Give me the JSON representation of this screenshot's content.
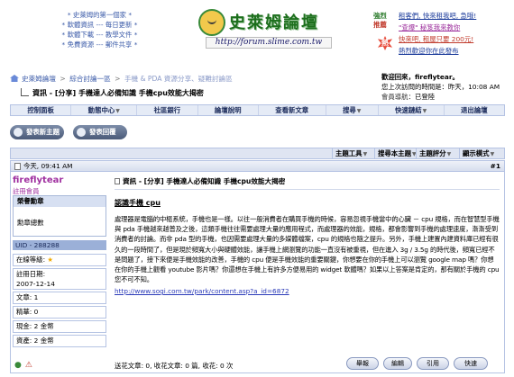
{
  "banner": {
    "promo_left": [
      "* 史萊姆的第一個家 *",
      "* 軟體資訊 --- 每日更新 *",
      "* 軟體下載 --- 教學文件 *",
      "* 免費資源 --- 郵件共享 *"
    ],
    "logo_title": "史萊姆論壇",
    "logo_url": "http://forum.slime.com.tw",
    "promo_right": {
      "tag_a": "強烈",
      "tag_b": "推薦",
      "badge": "熱",
      "lines": [
        "租客們, 快來租我吧, 急哦!",
        "\"查爆\" 秘笈我來教你",
        "快來吧, 租屋只要 200元!",
        "熱烈歡迎你在此發布"
      ]
    }
  },
  "breadcrumb": {
    "items": [
      "史萊姆論壇",
      "綜合討論一區",
      "手機 & PDA 資源分享、疑難討論區"
    ],
    "separator": ">"
  },
  "thread_title": "資訊 - [分享] 手機達人必備知識  手機cpu效能大揭密",
  "user_panel": {
    "greeting": "歡迎回來，fireflytear。",
    "last_visit": "您上次訪問的時間是：昨天，10:08 AM",
    "member_info_label": "會員導航：",
    "member_info_value": "已登陸"
  },
  "navbar": {
    "items": [
      {
        "label": "控制面板",
        "caret": false
      },
      {
        "label": "動態中心",
        "caret": true
      },
      {
        "label": "社區銀行",
        "caret": false
      },
      {
        "label": "論壇說明",
        "caret": false
      },
      {
        "label": "查看新文章",
        "caret": false
      },
      {
        "label": "搜尋",
        "caret": true
      },
      {
        "label": "快速鏈結",
        "caret": true
      },
      {
        "label": "退出論壇",
        "caret": false
      }
    ]
  },
  "actions": {
    "new_thread": "發表新主題",
    "reply": "發表回覆"
  },
  "thread_tools": {
    "tools": "主題工具",
    "search": "搜尋本主題",
    "rate": "主題評分",
    "display": "顯示模式"
  },
  "post": {
    "time": "今天, 09:41 AM",
    "number": "#1",
    "author": {
      "name": "fireflytear",
      "role": "註冊會員",
      "honor_title": "榮譽勳章",
      "honor_row": "勳章總數",
      "uid": "UID - 288288",
      "stats": [
        {
          "label": "在線等級:",
          "value": "★"
        },
        {
          "label": "註冊日期:",
          "value": "2007-12-14"
        },
        {
          "label": "文章:",
          "value": "1"
        },
        {
          "label": "精華:",
          "value": "0"
        },
        {
          "label": "現金:",
          "value": "2 金幣"
        },
        {
          "label": "資產:",
          "value": "2 金幣"
        }
      ]
    },
    "subject": "資訊 - [分享] 手機達人必備知識  手機cpu效能大揭密",
    "heading": "認識手機 cpu",
    "body": "處理器是電腦的中樞系統，手機也是一樣。以往一般消費者在購買手機的時候，容易忽視手機當中的心臟 － cpu 規格，而在智慧型手機與 pda 手機越來越普及之後，這類手機往往需要處理大量的應用程式，而處理器的效能，規格，都會影響到手機的處理速度，漸漸受到消費者的討論。而非 pda 型的手機，也因需要處理大量的多媒體檔案，cpu 的規格也隨之提升。另外，手機上建置內建資料庫已經有很久的一段時間了，但是現於頻寬大小與硬體效能，讓手機上網瀏覽的功能一直沒有被重視，但在進入 3g / 3.5g 的時代後，頻寬已經不是問題了，接下來便是手機效能的改善，手機的 cpu 便是手機效能的重要關鍵，你想要在你的手機上可以瀏覽 google map 嗎？你想在你的手機上觀看 youtube 影片嗎？你還想在手機上有許多方便易用的 widget 軟體嗎？如果以上答案是肯定的，那有關於手機的 cpu 您不可不知。",
    "link": "http://www.sogi.com.tw/park/content.asp?a_id=6872",
    "footer_stats": "送花文章: 0, 收花文章: 0 篇, 收花: 0 次",
    "buttons": {
      "report": "舉報",
      "edit": "編輯",
      "quote": "引用",
      "quick": "快速"
    }
  }
}
